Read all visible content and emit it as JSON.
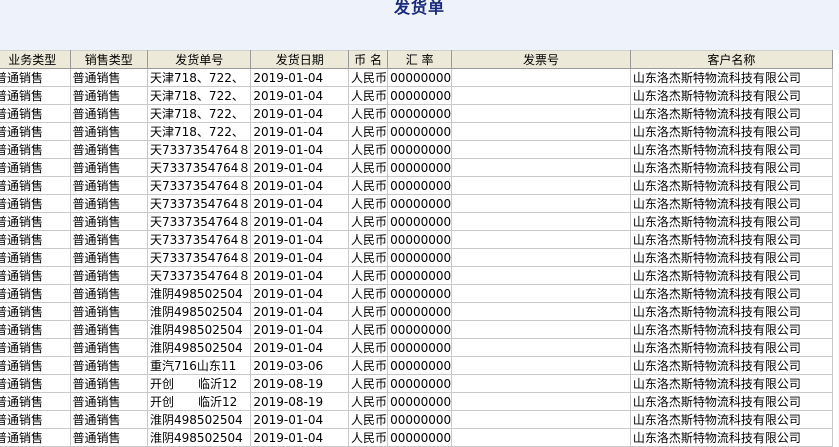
{
  "title": "发货单",
  "columns": [
    "业务类型",
    "销售类型",
    "发货单号",
    "发货日期",
    "币 名",
    "汇 率",
    "发票号",
    "客户名称"
  ],
  "rows": [
    [
      "普通销售",
      "普通销售",
      "天津718、722、",
      "2019-01-04",
      "人民币",
      "00000000",
      "",
      "山东洛杰斯特物流科技有限公司"
    ],
    [
      "普通销售",
      "普通销售",
      "天津718、722、",
      "2019-01-04",
      "人民币",
      "00000000",
      "",
      "山东洛杰斯特物流科技有限公司"
    ],
    [
      "普通销售",
      "普通销售",
      "天津718、722、",
      "2019-01-04",
      "人民币",
      "00000000",
      "",
      "山东洛杰斯特物流科技有限公司"
    ],
    [
      "普通销售",
      "普通销售",
      "天津718、722、",
      "2019-01-04",
      "人民币",
      "00000000",
      "",
      "山东洛杰斯特物流科技有限公司"
    ],
    [
      "普通销售",
      "普通销售",
      "天7337354764８",
      "2019-01-04",
      "人民币",
      "00000000",
      "",
      "山东洛杰斯特物流科技有限公司"
    ],
    [
      "普通销售",
      "普通销售",
      "天7337354764８",
      "2019-01-04",
      "人民币",
      "00000000",
      "",
      "山东洛杰斯特物流科技有限公司"
    ],
    [
      "普通销售",
      "普通销售",
      "天7337354764８",
      "2019-01-04",
      "人民币",
      "00000000",
      "",
      "山东洛杰斯特物流科技有限公司"
    ],
    [
      "普通销售",
      "普通销售",
      "天7337354764８",
      "2019-01-04",
      "人民币",
      "00000000",
      "",
      "山东洛杰斯特物流科技有限公司"
    ],
    [
      "普通销售",
      "普通销售",
      "天7337354764８",
      "2019-01-04",
      "人民币",
      "00000000",
      "",
      "山东洛杰斯特物流科技有限公司"
    ],
    [
      "普通销售",
      "普通销售",
      "天7337354764８",
      "2019-01-04",
      "人民币",
      "00000000",
      "",
      "山东洛杰斯特物流科技有限公司"
    ],
    [
      "普通销售",
      "普通销售",
      "天7337354764８",
      "2019-01-04",
      "人民币",
      "00000000",
      "",
      "山东洛杰斯特物流科技有限公司"
    ],
    [
      "普通销售",
      "普通销售",
      "天7337354764８",
      "2019-01-04",
      "人民币",
      "00000000",
      "",
      "山东洛杰斯特物流科技有限公司"
    ],
    [
      "普通销售",
      "普通销售",
      "淮阴498502504",
      "2019-01-04",
      "人民币",
      "00000000",
      "",
      "山东洛杰斯特物流科技有限公司"
    ],
    [
      "普通销售",
      "普通销售",
      "淮阴498502504",
      "2019-01-04",
      "人民币",
      "00000000",
      "",
      "山东洛杰斯特物流科技有限公司"
    ],
    [
      "普通销售",
      "普通销售",
      "淮阴498502504",
      "2019-01-04",
      "人民币",
      "00000000",
      "",
      "山东洛杰斯特物流科技有限公司"
    ],
    [
      "普通销售",
      "普通销售",
      "淮阴498502504",
      "2019-01-04",
      "人民币",
      "00000000",
      "",
      "山东洛杰斯特物流科技有限公司"
    ],
    [
      "普通销售",
      "普通销售",
      "重汽716山东11",
      "2019-03-06",
      "人民币",
      "00000000",
      "",
      "山东洛杰斯特物流科技有限公司"
    ],
    [
      "普通销售",
      "普通销售",
      "开创　　临沂12",
      "2019-08-19",
      "人民币",
      "00000000",
      "",
      "山东洛杰斯特物流科技有限公司"
    ],
    [
      "普通销售",
      "普通销售",
      "开创　　临沂12",
      "2019-08-19",
      "人民币",
      "00000000",
      "",
      "山东洛杰斯特物流科技有限公司"
    ],
    [
      "普通销售",
      "普通销售",
      "淮阴498502504",
      "2019-01-04",
      "人民币",
      "00000000",
      "",
      "山东洛杰斯特物流科技有限公司"
    ],
    [
      "普通销售",
      "普通销售",
      "淮阴498502504",
      "2019-01-04",
      "人民币",
      "00000000",
      "",
      "山东洛杰斯特物流科技有限公司"
    ],
    [
      "普通销售",
      "普通销售",
      "淮阴498502504",
      "2019-01-04",
      "人民币",
      "00000000",
      "",
      "山东洛杰斯特物流科技有限公司"
    ]
  ]
}
